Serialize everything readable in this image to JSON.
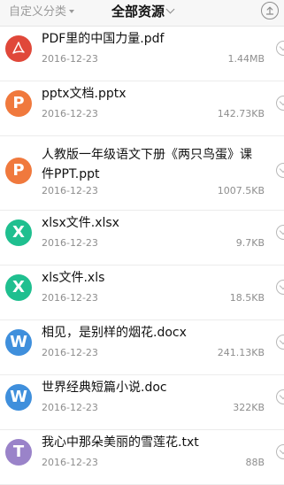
{
  "header": {
    "custom_category": "自定义分类",
    "all_resources": "全部资源",
    "upload_icon": "upload-icon"
  },
  "files": [
    {
      "name": "PDF里的中国力量.pdf",
      "date": "2016-12-23",
      "size": "1.44MB",
      "icon_letter": "",
      "icon": "pdf-icon",
      "color": "#e0483a"
    },
    {
      "name": "pptx文档.pptx",
      "date": "2016-12-23",
      "size": "142.73KB",
      "icon_letter": "P",
      "icon": "powerpoint-icon",
      "color": "#f0793d"
    },
    {
      "name": "人教版一年级语文下册《两只鸟蛋》课件PPT.ppt",
      "date": "2016-12-23",
      "size": "1007.5KB",
      "icon_letter": "P",
      "icon": "powerpoint-icon",
      "color": "#f0793d"
    },
    {
      "name": "xlsx文件.xlsx",
      "date": "2016-12-23",
      "size": "9.7KB",
      "icon_letter": "X",
      "icon": "excel-icon",
      "color": "#1fbf8f"
    },
    {
      "name": "xls文件.xls",
      "date": "2016-12-23",
      "size": "18.5KB",
      "icon_letter": "X",
      "icon": "excel-icon",
      "color": "#1fbf8f"
    },
    {
      "name": "相见，是别样的烟花.docx",
      "date": "2016-12-23",
      "size": "241.13KB",
      "icon_letter": "W",
      "icon": "word-icon",
      "color": "#3f8fdc"
    },
    {
      "name": "世界经典短篇小说.doc",
      "date": "2016-12-23",
      "size": "322KB",
      "icon_letter": "W",
      "icon": "word-icon",
      "color": "#3f8fdc"
    },
    {
      "name": "我心中那朵美丽的雪莲花.txt",
      "date": "2016-12-23",
      "size": "88B",
      "icon_letter": "T",
      "icon": "text-icon",
      "color": "#9a83c9"
    }
  ]
}
